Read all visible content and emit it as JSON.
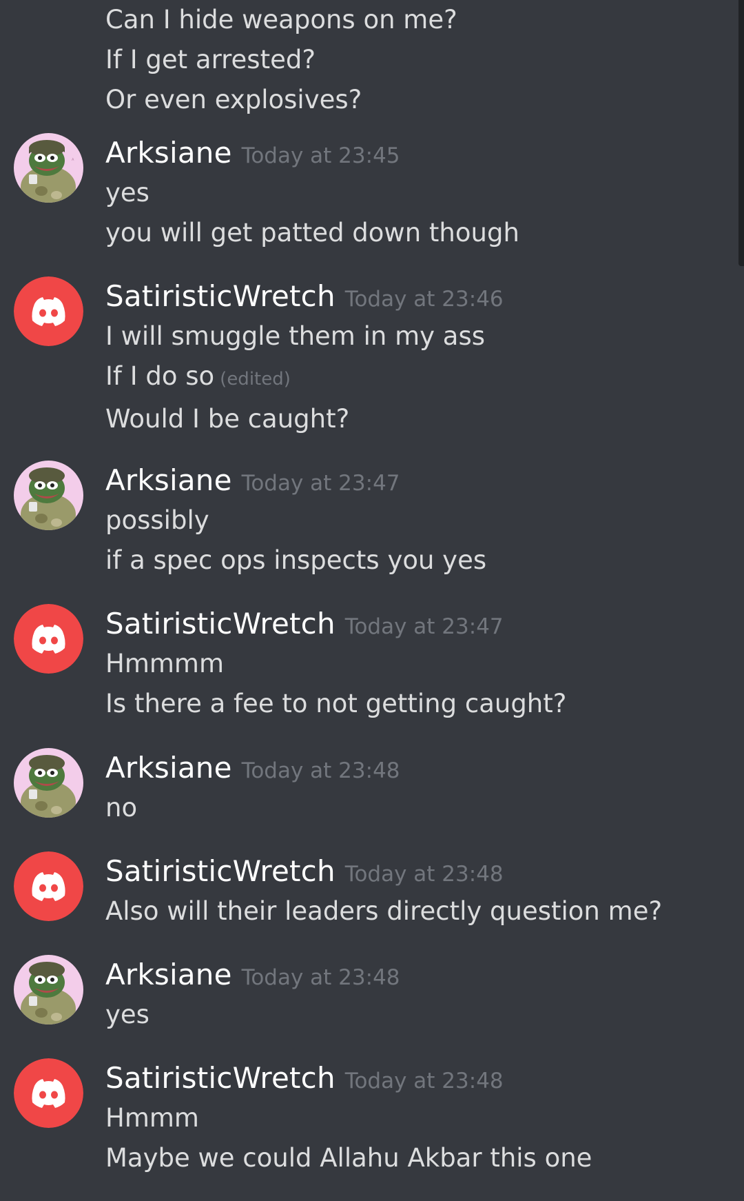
{
  "continued_messages": [
    "Can I hide weapons on me?",
    "If I get arrested?",
    "Or even explosives?"
  ],
  "messages": [
    {
      "author": "Arksiane",
      "avatar": "pepe-soldier-avatar",
      "timestamp": "Today at 23:45",
      "lines": [
        {
          "text": "yes"
        },
        {
          "text": "you will get patted down though"
        }
      ]
    },
    {
      "author": "SatiristicWretch",
      "avatar": "discord-default-avatar",
      "timestamp": "Today at 23:46",
      "lines": [
        {
          "text": "I will smuggle them in my ass"
        },
        {
          "text": "If I do so",
          "edited": "(edited)"
        },
        {
          "text": "Would I be caught?"
        }
      ]
    },
    {
      "author": "Arksiane",
      "avatar": "pepe-soldier-avatar",
      "timestamp": "Today at 23:47",
      "lines": [
        {
          "text": "possibly"
        },
        {
          "text": "if a spec ops inspects you yes"
        }
      ]
    },
    {
      "author": "SatiristicWretch",
      "avatar": "discord-default-avatar",
      "timestamp": "Today at 23:47",
      "lines": [
        {
          "text": "Hmmmm"
        },
        {
          "text": "Is there a fee to not getting caught?"
        }
      ]
    },
    {
      "author": "Arksiane",
      "avatar": "pepe-soldier-avatar",
      "timestamp": "Today at 23:48",
      "lines": [
        {
          "text": "no"
        }
      ]
    },
    {
      "author": "SatiristicWretch",
      "avatar": "discord-default-avatar",
      "timestamp": "Today at 23:48",
      "lines": [
        {
          "text": "Also will their leaders directly question me?"
        }
      ]
    },
    {
      "author": "Arksiane",
      "avatar": "pepe-soldier-avatar",
      "timestamp": "Today at 23:48",
      "lines": [
        {
          "text": "yes"
        }
      ]
    },
    {
      "author": "SatiristicWretch",
      "avatar": "discord-default-avatar",
      "timestamp": "Today at 23:48",
      "lines": [
        {
          "text": "Hmmm"
        },
        {
          "text": "Maybe we could Allahu Akbar this one"
        }
      ]
    }
  ],
  "colors": {
    "background": "#36393f",
    "username": "#ffffff",
    "message_text": "#dcddde",
    "timestamp": "#72767d",
    "discord_avatar": "#f04747"
  }
}
